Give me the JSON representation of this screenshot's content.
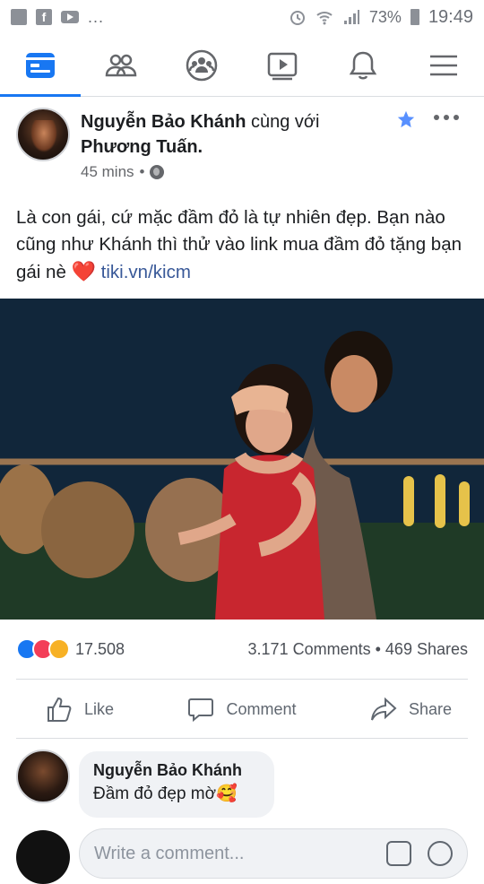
{
  "status_bar": {
    "icons": [
      "notification-icon",
      "facebook-icon",
      "youtube-icon"
    ],
    "overflow": "...",
    "battery": "73%",
    "time": "19:49"
  },
  "nav": {
    "items": [
      {
        "name": "news-feed",
        "active": true
      },
      {
        "name": "friends"
      },
      {
        "name": "groups"
      },
      {
        "name": "watch"
      },
      {
        "name": "notifications"
      },
      {
        "name": "menu"
      }
    ],
    "accent": "#1877f2"
  },
  "post": {
    "author": "Nguyễn Bảo Khánh",
    "with_text": " cùng với ",
    "tagged": "Phương Tuấn.",
    "time": "45 mins",
    "separator": "•",
    "text": "Là con gái, cứ mặc đầm đỏ là tự nhiên đẹp. Bạn nào cũng như Khánh thì thử vào link mua đầm đỏ tặng bạn gái nè ",
    "heart": "❤️",
    "link": "tiki.vn/kicm"
  },
  "reactions": {
    "count": "17.508",
    "comments": "3.171 Comments",
    "shares": "469 Shares",
    "dot": " • "
  },
  "actions": {
    "like": "Like",
    "comment": "Comment",
    "share": "Share"
  },
  "comment": {
    "name": "Nguyễn Bảo Khánh",
    "text": "Đầm đỏ đẹp mờ🥰"
  },
  "write_comment": {
    "placeholder": "Write a comment..."
  }
}
